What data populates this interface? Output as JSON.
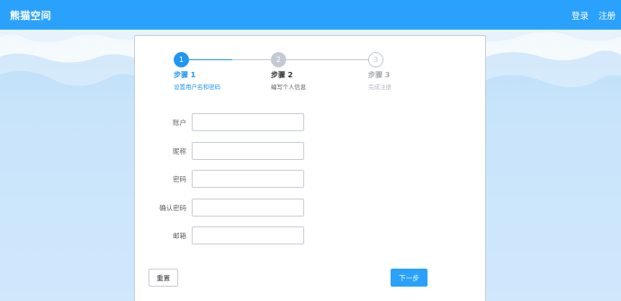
{
  "header": {
    "brand": "熊猫空间",
    "login_label": "登录",
    "register_label": "注册"
  },
  "colors": {
    "primary": "#2aa2fd",
    "step_active": "#2196f3",
    "step_pending": "#c4cad4"
  },
  "steps": [
    {
      "number": "1",
      "title": "步骤 1",
      "desc": "设置用户名和密码",
      "state": "active"
    },
    {
      "number": "2",
      "title": "步骤 2",
      "desc": "编写个人信息",
      "state": "pending"
    },
    {
      "number": "3",
      "title": "步骤 3",
      "desc": "完成注册",
      "state": "todo"
    }
  ],
  "form": {
    "fields": [
      {
        "label": "账户",
        "value": "",
        "placeholder": ""
      },
      {
        "label": "昵称",
        "value": "",
        "placeholder": ""
      },
      {
        "label": "密码",
        "value": "",
        "placeholder": ""
      },
      {
        "label": "确认密码",
        "value": "",
        "placeholder": ""
      },
      {
        "label": "邮箱",
        "value": "",
        "placeholder": ""
      }
    ]
  },
  "buttons": {
    "reset_label": "重置",
    "next_label": "下一步"
  }
}
